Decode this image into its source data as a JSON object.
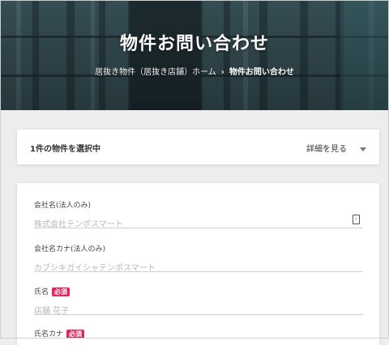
{
  "hero": {
    "title": "物件お問い合わせ",
    "breadcrumb": {
      "parent": "居抜き物件（居抜き店舗）ホーム",
      "separator": "›",
      "current": "物件お問い合わせ"
    }
  },
  "selected": {
    "label": "1件の物件を選択中",
    "details_label": "詳細を見る"
  },
  "form": {
    "fields": [
      {
        "label": "会社名(法人のみ)",
        "placeholder": "株式会社テンポスマート",
        "required": false
      },
      {
        "label": "会社名カナ(法人のみ)",
        "placeholder": "カブシキガイシャテンポスマート",
        "required": false
      },
      {
        "label": "氏名",
        "placeholder": "店舗 花子",
        "required": true
      },
      {
        "label": "氏名カナ",
        "placeholder": "",
        "required": true
      }
    ],
    "required_badge": "必須"
  },
  "colors": {
    "required": "#e0245e",
    "hero_overlay": "#22353a",
    "page_bg": "#ededed"
  }
}
